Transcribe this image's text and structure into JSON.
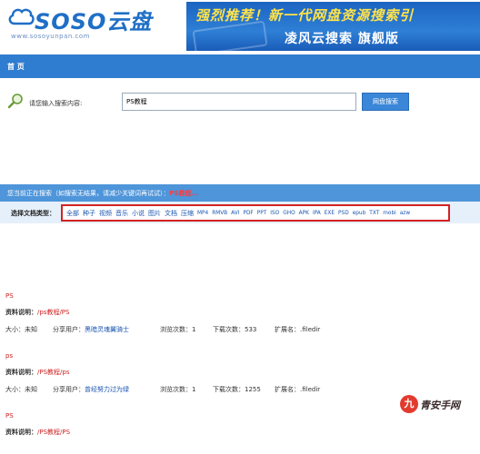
{
  "header": {
    "logo_text": "SOSO",
    "logo_yun": "云盘",
    "logo_url": "www.sosoyunpan.com",
    "banner_line1": "强烈推荐！新一代网盘资源搜索引",
    "banner_line2": "凌风云搜索 旗舰版"
  },
  "nav": {
    "home": "首 页"
  },
  "search": {
    "label": "请您输入搜索内容:",
    "value": "PS教程",
    "button": "网盘搜索"
  },
  "searching": {
    "prefix": "您当前正在搜索（如搜索无结果，请减少关键词再试试）：",
    "keyword": "PS教程..."
  },
  "types": {
    "label": "选择文档类型：",
    "items": [
      "全部",
      "种子",
      "视频",
      "音乐",
      "小说",
      "图片",
      "文档",
      "压缩"
    ],
    "small_items": [
      "MP4",
      "RMVB",
      "AVI",
      "PDF",
      "PPT",
      "ISO",
      "GHO",
      "APK",
      "IPA",
      "EXE",
      "PSD",
      "epub",
      "TXT",
      "mobi",
      "azw"
    ]
  },
  "results": [
    {
      "title": "PS",
      "desc_label": "资料说明：",
      "path": "/ps教程/PS",
      "size": "大小：未知",
      "user_label": "分享用户：",
      "user": "黑暗灵魂翼骑士",
      "views": "浏览次数：1",
      "downloads": "下载次数：533",
      "ext": "扩展名：.filedir"
    },
    {
      "title": "ps",
      "desc_label": "资料说明：",
      "path": "/PS教程/ps",
      "size": "大小：未知",
      "user_label": "分享用户：",
      "user": "曾经努力过为绿",
      "views": "浏览次数：1",
      "downloads": "下载次数：1255",
      "ext": "扩展名：.filedir"
    },
    {
      "title": "PS",
      "desc_label": "资料说明：",
      "path": "/PS教程/PS",
      "size": "",
      "user_label": "",
      "user": "",
      "views": "",
      "downloads": "",
      "ext": ""
    }
  ],
  "watermark": {
    "circle": "九",
    "text": "青安手网"
  },
  "colors": {
    "nav_blue": "#2f7dd0",
    "title_red": "#cc2222",
    "link_blue": "#1a55b0"
  }
}
